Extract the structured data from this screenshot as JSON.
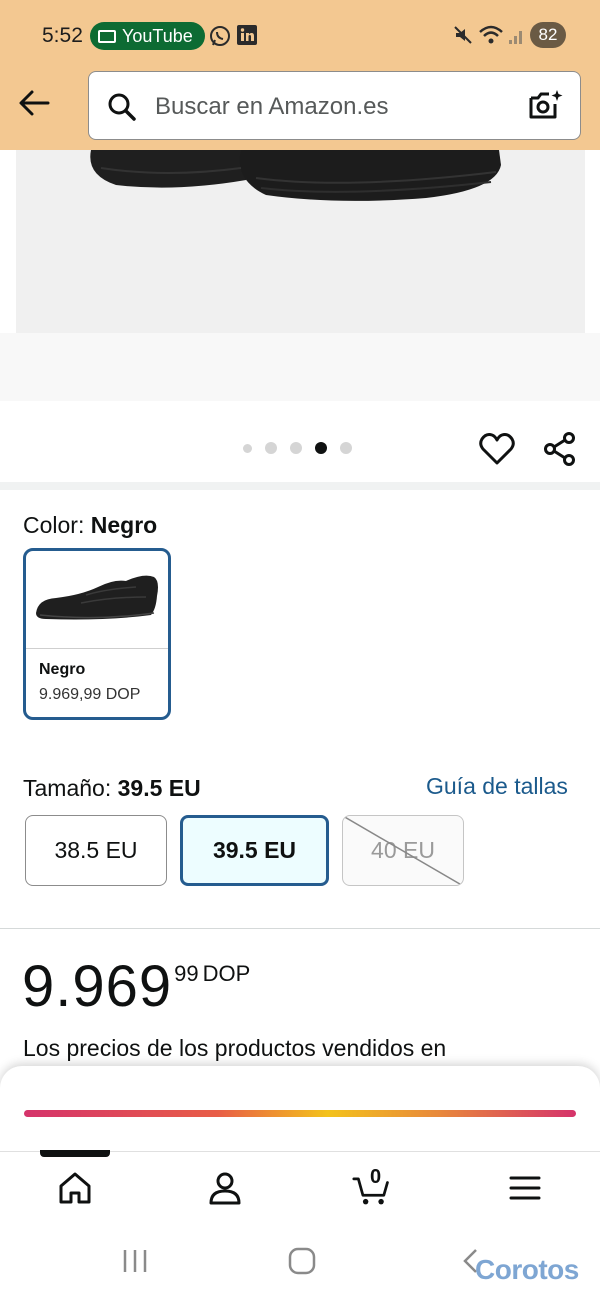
{
  "status_bar": {
    "time": "5:52",
    "notification_app": "YouTube",
    "battery": "82"
  },
  "search": {
    "placeholder": "Buscar en Amazon.es"
  },
  "gallery": {
    "dot_count": 5,
    "active_index": 3
  },
  "color": {
    "label": "Color: ",
    "value": "Negro",
    "swatch": {
      "name": "Negro",
      "price": "9.969,99 DOP"
    }
  },
  "size": {
    "label": "Tamaño: ",
    "value": "39.5 EU",
    "guide_link": "Guía de tallas",
    "options": [
      {
        "label": "38.5 EU",
        "state": "available"
      },
      {
        "label": "39.5 EU",
        "state": "selected"
      },
      {
        "label": "40 EU",
        "state": "unavailable"
      }
    ]
  },
  "price": {
    "whole": "9.969",
    "fraction": "99",
    "currency": "DOP",
    "note": "Los precios de los productos vendidos en"
  },
  "bottom_nav": {
    "cart_count": "0"
  },
  "watermark": "Corotos",
  "colors": {
    "header_bg": "#f3c891",
    "selected_border": "#255c8f",
    "link": "#1b5a8c"
  }
}
